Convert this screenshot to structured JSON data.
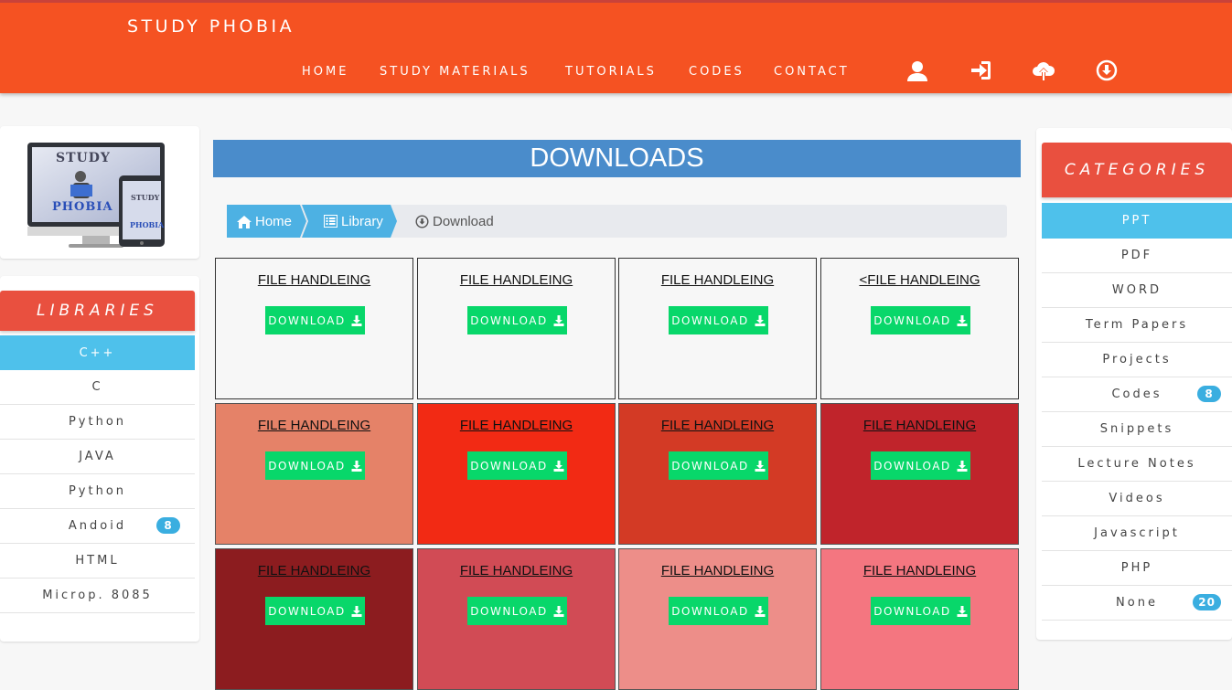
{
  "header": {
    "brand": "STUDY PHOBIA",
    "nav": [
      "HOME",
      "STUDY MATERIALS",
      "TUTORIALS",
      "CODES",
      "CONTACT"
    ],
    "icons": [
      "user-icon",
      "sign-in-icon",
      "cloud-upload-icon",
      "circle-download-icon"
    ]
  },
  "logo": {
    "line1": "STUDY",
    "line2": "PHOBIA",
    "tablet_line1": "STUDY",
    "tablet_line2": "PHOBIA"
  },
  "libraries": {
    "title": "LIBRARIES",
    "items": [
      {
        "label": "C++",
        "active": true
      },
      {
        "label": "C"
      },
      {
        "label": "Python"
      },
      {
        "label": "JAVA"
      },
      {
        "label": "Python"
      },
      {
        "label": "Andoid",
        "badge": "8"
      },
      {
        "label": "HTML"
      },
      {
        "label": "Microp. 8085"
      }
    ]
  },
  "main": {
    "title": "DOWNLOADS",
    "breadcrumb": {
      "home": "Home",
      "library": "Library",
      "current": "Download"
    },
    "tiles": [
      {
        "title": "FILE HANDLEING",
        "button": "DOWNLOAD",
        "color": "#f7f7f7"
      },
      {
        "title": "FILE HANDLEING",
        "button": "DOWNLOAD",
        "color": "#f7f7f7"
      },
      {
        "title": "FILE HANDLEING",
        "button": "DOWNLOAD",
        "color": "#f7f7f7"
      },
      {
        "title": "<FILE HANDLEING",
        "button": "DOWNLOAD",
        "color": "#f7f7f7"
      },
      {
        "title": "FILE HANDLEING",
        "button": "DOWNLOAD",
        "color": "#e58268"
      },
      {
        "title": "FILE HANDLEING",
        "button": "DOWNLOAD",
        "color": "#f22a14"
      },
      {
        "title": "FILE HANDLEING",
        "button": "DOWNLOAD",
        "color": "#d33a25"
      },
      {
        "title": "FILE HANDLEING",
        "button": "DOWNLOAD",
        "color": "#c0242b"
      },
      {
        "title": "FILE HANDLEING",
        "button": "DOWNLOAD",
        "color": "#8c1c1f"
      },
      {
        "title": "FILE HANDLEING",
        "button": "DOWNLOAD",
        "color": "#d14b55"
      },
      {
        "title": "FILE HANDLEING",
        "button": "DOWNLOAD",
        "color": "#ed8e89"
      },
      {
        "title": "FILE HANDLEING",
        "button": "DOWNLOAD",
        "color": "#f47680"
      }
    ]
  },
  "categories": {
    "title": "CATEGORIES",
    "items": [
      {
        "label": "PPT",
        "active": true
      },
      {
        "label": "PDF"
      },
      {
        "label": "WORD"
      },
      {
        "label": "Term Papers"
      },
      {
        "label": "Projects"
      },
      {
        "label": "Codes",
        "badge": "8"
      },
      {
        "label": "Snippets"
      },
      {
        "label": "Lecture Notes"
      },
      {
        "label": "Videos"
      },
      {
        "label": "Javascript"
      },
      {
        "label": "PHP"
      },
      {
        "label": "None",
        "badge": "20"
      }
    ]
  },
  "colors": {
    "header": "#f55222",
    "panel_head": "#e9503f",
    "active": "#4ec1eb",
    "download": "#08d76a",
    "title_bar": "#4a8ccb"
  }
}
